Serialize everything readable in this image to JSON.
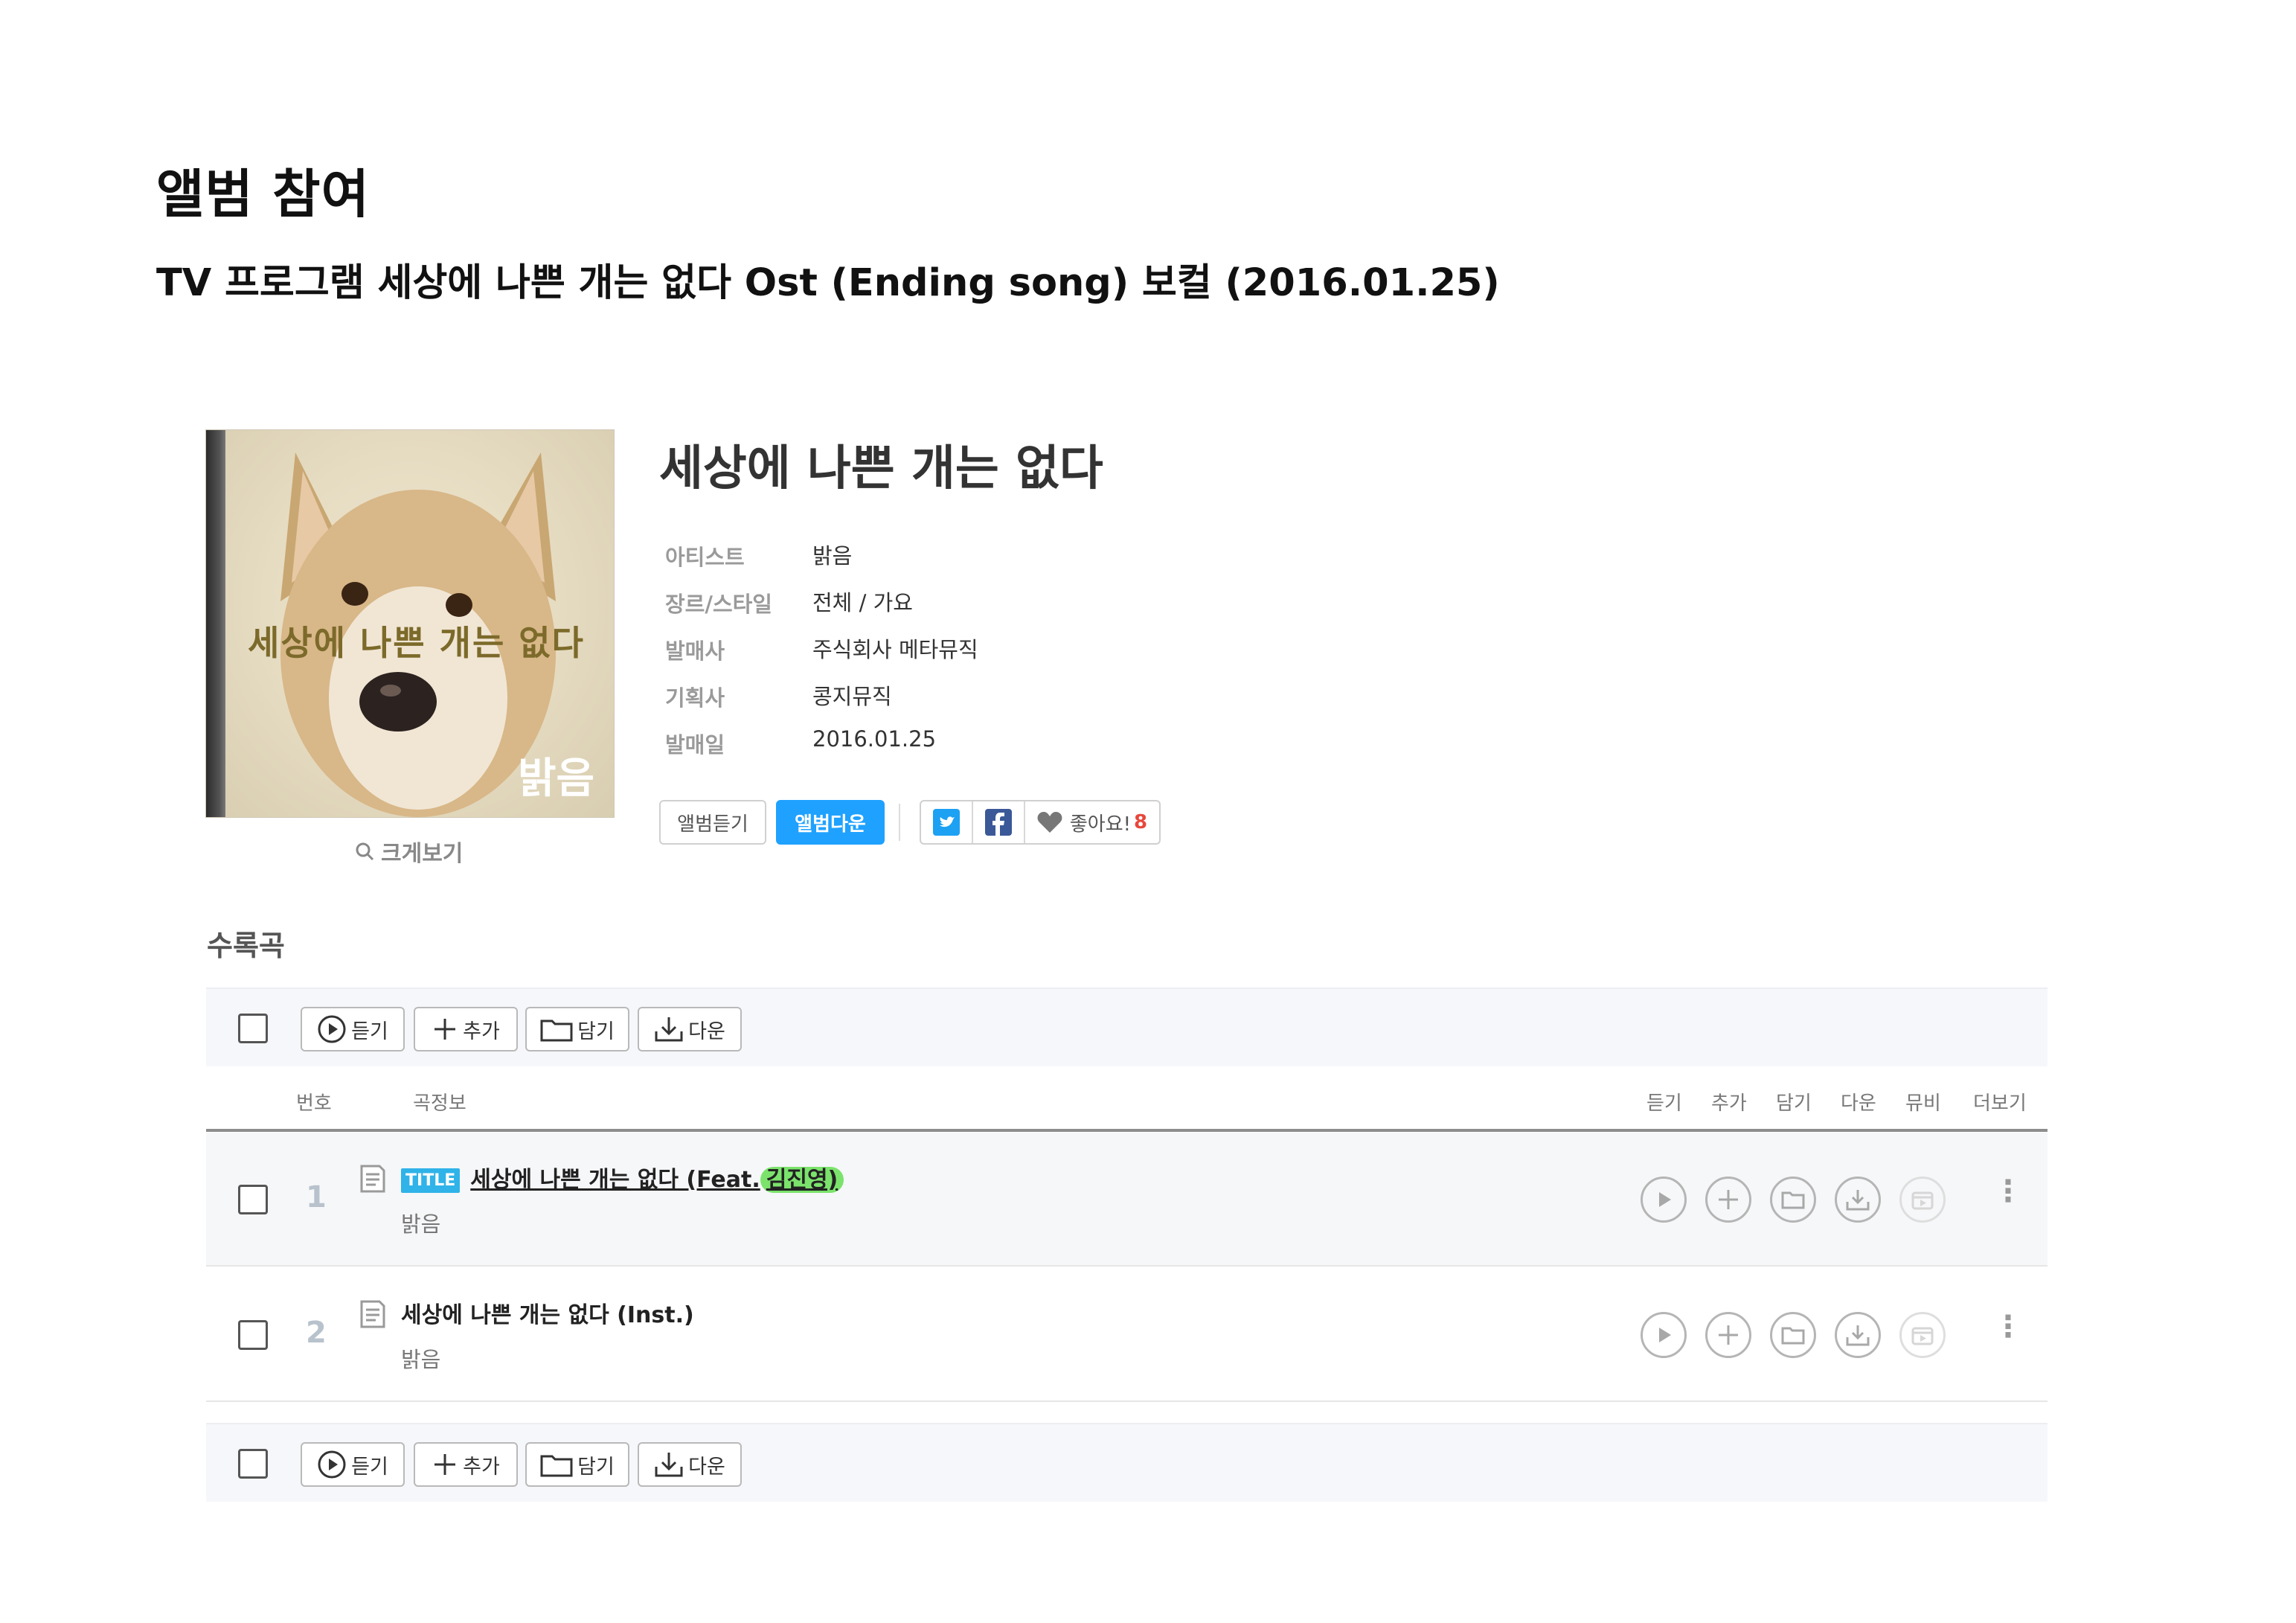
{
  "heading": "앨범 참여",
  "subheading": "TV 프로그램 세상에 나쁜 개는 없다 Ost (Ending song) 보컬 (2016.01.25)",
  "cover": {
    "title_text": "세상에 나쁜 개는 없다",
    "artist_text": "밝음"
  },
  "zoom_label": "크게보기",
  "album": {
    "title": "세상에 나쁜 개는 없다",
    "info": [
      {
        "label": "아티스트",
        "value": "밝음"
      },
      {
        "label": "장르/스타일",
        "value": "전체 / 가요"
      },
      {
        "label": "발매사",
        "value": "주식회사 메타뮤직"
      },
      {
        "label": "기획사",
        "value": "콩지뮤직"
      },
      {
        "label": "발매일",
        "value": "2016.01.25"
      }
    ],
    "play_label": "앨범듣기",
    "download_label": "앨범다운",
    "like_label": "좋아요!",
    "like_count": "8"
  },
  "tracks_title": "수록곡",
  "toolbar": {
    "play": "듣기",
    "add": "추가",
    "save": "담기",
    "download": "다운"
  },
  "columns": {
    "number": "번호",
    "info": "곡정보",
    "play": "듣기",
    "add": "추가",
    "save": "담기",
    "download": "다운",
    "mv": "뮤비",
    "more": "더보기"
  },
  "tracks": [
    {
      "number": "1",
      "badge": "TITLE",
      "title": "세상에 나쁜 개는 없다 (Feat.",
      "feat": "김진영)",
      "artist": "밝음"
    },
    {
      "number": "2",
      "title": "세상에 나쁜 개는 없다 (Inst.)",
      "artist": "밝음"
    }
  ],
  "colors": {
    "accent": "#1fa1ff",
    "title_badge": "#2fb3e8",
    "highlight": "#7be36c",
    "like_count": "#e8473b"
  }
}
